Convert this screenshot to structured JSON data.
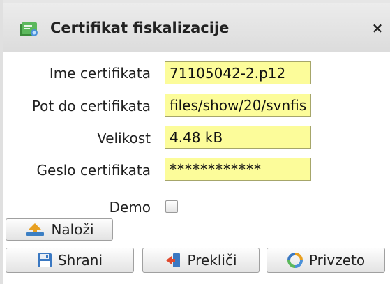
{
  "dialog": {
    "title": "Certifikat fiskalizacije",
    "close_symbol": "×"
  },
  "form": {
    "name_label": "Ime certifikata",
    "name_value": "71105042-2.p12",
    "path_label": "Pot do certifikata",
    "path_value": "files/show/20/svnfis",
    "size_label": "Velikost",
    "size_value": "4.48 kB",
    "password_label": "Geslo certifikata",
    "password_value": "************",
    "demo_label": "Demo",
    "demo_checked": false
  },
  "buttons": {
    "upload": "Naloži",
    "save": "Shrani",
    "cancel": "Prekliči",
    "default": "Privzeto"
  },
  "icons": {
    "title": "certificate-icon",
    "upload": "upload-arrow-icon",
    "save": "floppy-disk-icon",
    "cancel": "exit-door-icon",
    "default": "refresh-icon"
  },
  "colors": {
    "field_background": "#fcfc9a",
    "titlebar": "#e4e4e4"
  }
}
